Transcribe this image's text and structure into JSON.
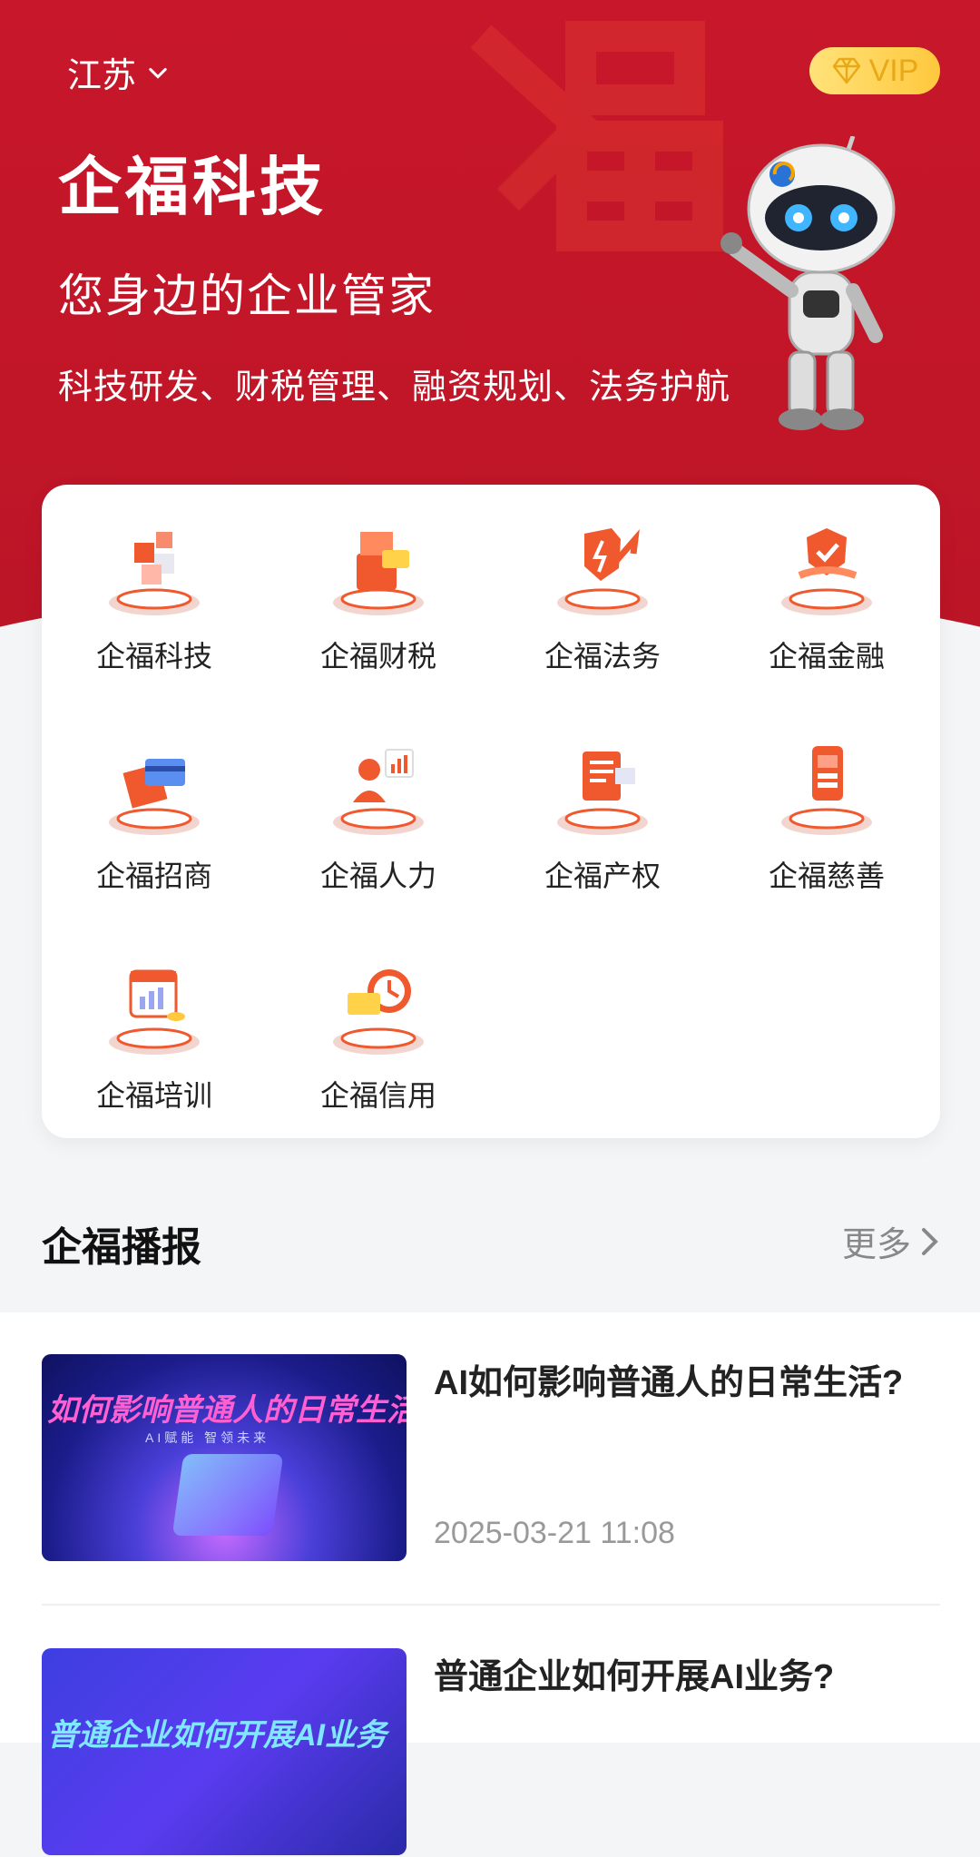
{
  "header": {
    "region": "江苏",
    "vip": "VIP",
    "title": "企福科技",
    "subtitle": "您身边的企业管家",
    "tagline": "科技研发、财税管理、融资规划、法务护航"
  },
  "services": [
    {
      "label": "企福科技",
      "icon": "tech-cubes-icon"
    },
    {
      "label": "企福财税",
      "icon": "tax-box-icon"
    },
    {
      "label": "企福法务",
      "icon": "legal-shield-icon"
    },
    {
      "label": "企福金融",
      "icon": "finance-shield-icon"
    },
    {
      "label": "企福招商",
      "icon": "investment-card-icon"
    },
    {
      "label": "企福人力",
      "icon": "hr-person-icon"
    },
    {
      "label": "企福产权",
      "icon": "property-document-icon"
    },
    {
      "label": "企福慈善",
      "icon": "charity-phone-icon"
    },
    {
      "label": "企福培训",
      "icon": "training-calendar-icon"
    },
    {
      "label": "企福信用",
      "icon": "credit-clock-icon"
    }
  ],
  "news": {
    "title": "企福播报",
    "more": "更多",
    "items": [
      {
        "title": "AI如何影响普通人的日常生活?",
        "time": "2025-03-21 11:08",
        "thumb_caption": "如何影响普通人的日常生活",
        "thumb_sub": "AI赋能 智领未来"
      },
      {
        "title": "普通企业如何开展AI业务?",
        "time": "",
        "thumb_caption": "普通企业如何开展AI业务"
      }
    ]
  },
  "colors": {
    "brand_red": "#c8172a",
    "vip_gold": "#ffc83d",
    "accent_orange": "#f0582e"
  }
}
